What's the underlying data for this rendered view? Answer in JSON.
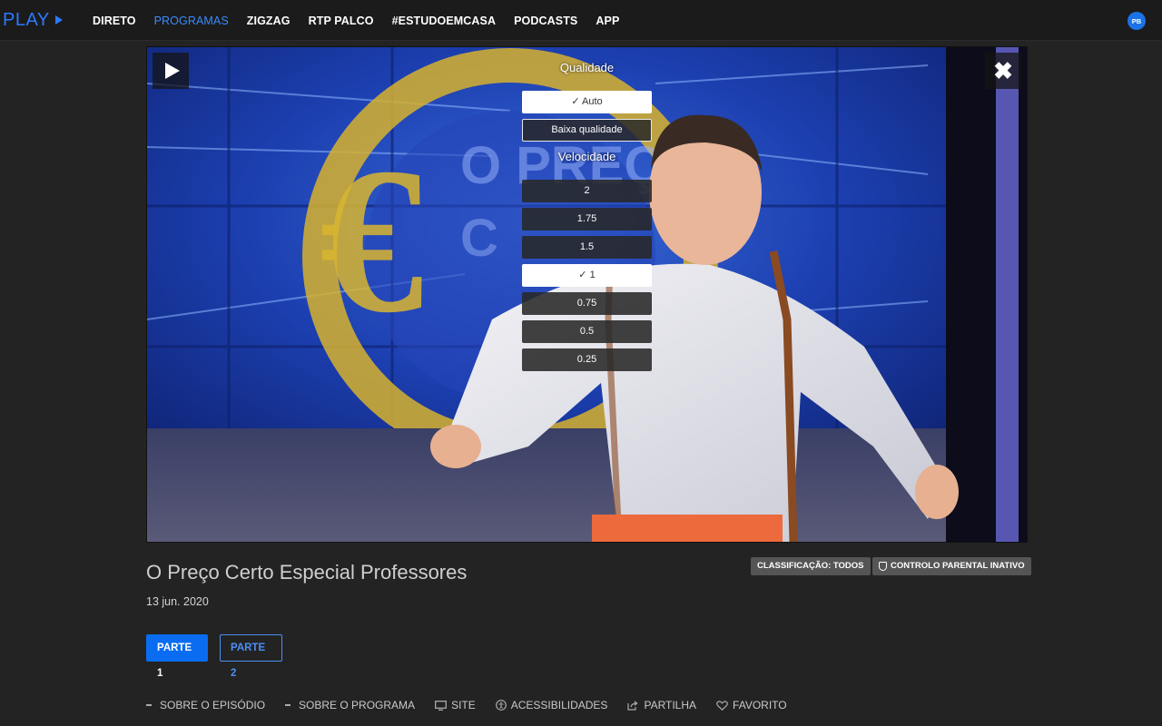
{
  "nav": {
    "logo": "PLAY",
    "items": [
      {
        "label": "DIRETO",
        "active": false
      },
      {
        "label": "PROGRAMAS",
        "active": true
      },
      {
        "label": "ZIGZAG",
        "active": false
      },
      {
        "label": "RTP PALCO",
        "active": false
      },
      {
        "label": "#ESTUDOEMCASA",
        "active": false
      },
      {
        "label": "PODCASTS",
        "active": false
      },
      {
        "label": "APP",
        "active": false
      }
    ],
    "avatar": "PB"
  },
  "player": {
    "play_icon": "play-icon",
    "close_icon": "close-icon",
    "close_glyph": "✖",
    "settings": {
      "quality_title": "Qualidade",
      "quality_options": [
        {
          "label": "✓ Auto",
          "selected": true
        },
        {
          "label": "Baixa qualidade",
          "selected": false
        }
      ],
      "speed_title": "Velocidade",
      "speed_options": [
        {
          "label": "2",
          "selected": false
        },
        {
          "label": "1.75",
          "selected": false
        },
        {
          "label": "1.5",
          "selected": false
        },
        {
          "label": "✓ 1",
          "selected": true
        },
        {
          "label": "0.75",
          "selected": false
        },
        {
          "label": "0.5",
          "selected": false
        },
        {
          "label": "0.25",
          "selected": false
        }
      ]
    }
  },
  "episode": {
    "title": "O Preço Certo Especial Professores",
    "date": "13 jun. 2020",
    "badges": {
      "classification": "CLASSIFICAÇÃO: TODOS",
      "parental": "CONTROLO PARENTAL INATIVO"
    },
    "parts": [
      "PARTE 1",
      "PARTE 2"
    ],
    "actions": [
      {
        "label": "SOBRE O EPISÓDIO",
        "icon": "list-icon"
      },
      {
        "label": "SOBRE O PROGRAMA",
        "icon": "list-icon"
      },
      {
        "label": "SITE",
        "icon": "monitor-icon"
      },
      {
        "label": "ACESSIBILIDADES",
        "icon": "accessibility-icon"
      },
      {
        "label": "PARTILHA",
        "icon": "share-icon"
      },
      {
        "label": "FAVORITO",
        "icon": "heart-icon"
      }
    ]
  },
  "colors": {
    "accent": "#0a6cf0",
    "background": "#232323",
    "nav_active": "#3a8bff"
  }
}
